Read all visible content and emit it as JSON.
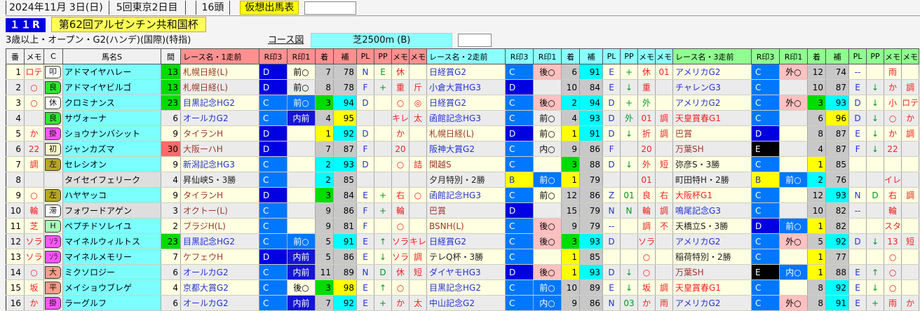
{
  "header": {
    "date": "2024年11月 3日(日)",
    "meeting": "5回東京2日目",
    "head_count": "16頭",
    "sheet_label": "仮想出馬表",
    "race_no": "１１R",
    "race_title": "第62回アルゼンチン共和国杯",
    "conditions": "3歳以上・オープン・G2(ハンデ)(国際)(特指)",
    "course_link": "コース図",
    "course": "芝2500m (B)"
  },
  "colors": {
    "top_bg": "#F4F4F4",
    "row_odd": "#FFFFE2",
    "row_even": "#EBEBEB",
    "name_cyan": "#7CFFFF",
    "name_gray": "#DEDEDE",
    "gap_green": "#00DC00",
    "gap_red": "#FF6A6A",
    "place1": "#FFFF00",
    "place2": "#00FFFF",
    "place3": "#00DC00",
    "place_other": "#C8C8C8",
    "mark_c": "#0077FF",
    "mark_d": "#0000E0",
    "mark_b_bg": "#FFFF00",
    "mark_e_bg": "#000000",
    "pos_pink": "#FFC0C0",
    "pos_blue": "#0077FF",
    "pos_navy": "#1414D2",
    "grade_g": "#2233CC",
    "grade_op": "#993928",
    "grade_g1": "#EE2222",
    "grade_cond": "#222222",
    "memo_red": "#EE2222",
    "pp_green": "#009922",
    "pl_blue": "#2233CC",
    "head_g1": "#FF9090",
    "head_g2": "#8CFFFF",
    "head_g3": "#90FF90",
    "head_left": "#F0F0F0",
    "race_no_bg": "#0000DD",
    "title_bg": "#FFFF55",
    "sheet_bg": "#FFFF00",
    "course_bg": "#8CFFFF",
    "tags": {
      "white": "#FFFFFF",
      "green": "#33E633",
      "magenta": "#FF55FF",
      "cream": "#FFF8C8",
      "olive": "#B8A820",
      "pgreen": "#AAFFBB",
      "salmon": "#FF9C8C"
    }
  },
  "table": {
    "left_columns": [
      "番",
      "メモ",
      "C",
      "馬名S",
      "間"
    ],
    "group_labels": [
      "レース名・1走前",
      "レース名・2走前",
      "レース名・3走前"
    ],
    "sub_columns": [
      "R印3",
      "R印1",
      "着",
      "補",
      "PL",
      "PP",
      "メモ",
      "メモ"
    ],
    "rows": [
      {
        "num": "1",
        "memo": "ロテ",
        "c": "叩",
        "cbg": "white",
        "name": "アドマイヤハレー",
        "nbg": "c",
        "gap": "13",
        "gbg": "g",
        "races": [
          {
            "race": "札幌日経(L)",
            "k": "o",
            "r3": "D",
            "r1": "前○",
            "r1s": "none",
            "fin": "7",
            "ho": "78",
            "pl": "N",
            "pp": "E",
            "m1": "休",
            "m2": ""
          },
          {
            "race": "日経賞G2",
            "k": "g",
            "r3": "C",
            "r1": "後○",
            "r1s": "pink",
            "fin": "6",
            "ho": "91",
            "pl": "E",
            "pp": "+",
            "m1": "休",
            "m2": "01"
          },
          {
            "race": "アメリカG2",
            "k": "g",
            "r3": "C",
            "r1": "外○",
            "r1s": "pink",
            "fin": "12",
            "ho": "74",
            "pl": "--",
            "pp": "",
            "m1": "雨",
            "m2": ""
          }
        ]
      },
      {
        "num": "2",
        "memo": "○",
        "c": "良",
        "cbg": "green",
        "name": "アドマイヤビルゴ",
        "nbg": "c",
        "gap": "13",
        "gbg": "g",
        "races": [
          {
            "race": "札幌日経(L)",
            "k": "o",
            "r3": "D",
            "r1": "前○",
            "r1s": "none",
            "fin": "8",
            "ho": "78",
            "pl": "F",
            "pp": "+",
            "m1": "重",
            "m2": "斤"
          },
          {
            "race": "小倉大賞HG3",
            "k": "g",
            "r3": "D",
            "r1": "",
            "r1s": "none",
            "fin": "10",
            "ho": "84",
            "pl": "E",
            "pp": "↓",
            "m1": "重",
            "m2": ""
          },
          {
            "race": "チャレンG3",
            "k": "g",
            "r3": "C",
            "r1": "",
            "r1s": "none",
            "fin": "10",
            "ho": "87",
            "pl": "E",
            "pp": "↓",
            "m1": "か",
            "m2": "調"
          }
        ]
      },
      {
        "num": "3",
        "memo": "○",
        "c": "休",
        "cbg": "white",
        "name": "クロミナンス",
        "nbg": "c",
        "gap": "23",
        "gbg": "g",
        "races": [
          {
            "race": "目黒記念HG2",
            "k": "g",
            "r3": "C",
            "r1": "前○",
            "r1s": "blue",
            "fin": "3",
            "ho": "94",
            "pl": "D",
            "pp": "",
            "m1": "○",
            "m2": "◎"
          },
          {
            "race": "日経賞G2",
            "k": "g",
            "r3": "C",
            "r1": "後○",
            "r1s": "pink",
            "fin": "2",
            "ho": "94",
            "pl": "D",
            "pp": "+",
            "m1": "外",
            "m1g": true,
            "m2": ""
          },
          {
            "race": "アメリカG2",
            "k": "g",
            "r3": "C",
            "r1": "外○",
            "r1s": "pink",
            "fin": "3",
            "ho": "93",
            "pl": "D",
            "pp": "↓",
            "m1": "小",
            "m2": "ロテ"
          }
        ]
      },
      {
        "num": "4",
        "memo": "",
        "c": "良",
        "cbg": "green",
        "name": "サヴォーナ",
        "nbg": "c",
        "gap": "6",
        "gbg": "",
        "races": [
          {
            "race": "オールカG2",
            "k": "g",
            "r3": "C",
            "r1": "内前",
            "r1s": "navy",
            "fin": "4",
            "ho": "95",
            "pl": "",
            "pp": "",
            "m1": "キレ",
            "m2": "太"
          },
          {
            "race": "函館記念HG3",
            "k": "g",
            "r3": "C",
            "r1": "前○",
            "r1s": "none",
            "fin": "4",
            "ho": "93",
            "pl": "D",
            "pp": "外",
            "m1": "01",
            "m2": "調"
          },
          {
            "race": "天皇賞春G1",
            "k": "1",
            "r3": "C",
            "r1": "",
            "r1s": "none",
            "fin": "6",
            "ho": "96",
            "pl": "D",
            "pp": "↓",
            "m1": "○",
            "m2": "か"
          }
        ]
      },
      {
        "num": "5",
        "memo": "か",
        "c": "掛",
        "cbg": "magenta",
        "name": "ショウナンバシット",
        "nbg": "c",
        "gap": "9",
        "gbg": "",
        "races": [
          {
            "race": "タイランH",
            "k": "o",
            "r3": "D",
            "r1": "",
            "r1s": "none",
            "fin": "1",
            "ho": "92",
            "pl": "D",
            "pp": "",
            "m1": "か",
            "m2": ""
          },
          {
            "race": "札幌日経(L)",
            "k": "o",
            "r3": "D",
            "r1": "前○",
            "r1s": "none",
            "fin": "1",
            "ho": "91",
            "pl": "D",
            "pp": "↓",
            "m1": "折",
            "m2": "調"
          },
          {
            "race": "巴賞",
            "k": "o",
            "r3": "D",
            "r1": "",
            "r1s": "none",
            "fin": "8",
            "ho": "87",
            "pl": "E",
            "pp": "↓",
            "m1": "か",
            "m2": "調"
          }
        ]
      },
      {
        "num": "6",
        "memo": "22",
        "c": "初",
        "cbg": "cream",
        "name": "ジャンカズマ",
        "nbg": "c",
        "gap": "30",
        "gbg": "r",
        "races": [
          {
            "race": "大阪ーハH",
            "k": "o",
            "r3": "D",
            "r1": "",
            "r1s": "none",
            "fin": "7",
            "ho": "87",
            "pl": "F",
            "pp": "",
            "m1": "20",
            "m2": ""
          },
          {
            "race": "阪神大賞G2",
            "k": "g",
            "r3": "C",
            "r1": "内○",
            "r1s": "none",
            "fin": "9",
            "ho": "86",
            "pl": "F",
            "pp": "",
            "m1": "20",
            "m2": ""
          },
          {
            "race": "万葉SH",
            "k": "o",
            "r3": "E",
            "r1": "",
            "r1s": "none",
            "fin": "4",
            "ho": "87",
            "pl": "F",
            "pp": "↓",
            "m1": "22",
            "m2": ""
          }
        ]
      },
      {
        "num": "7",
        "memo": "調",
        "c": "左",
        "cbg": "olive",
        "name": "セレシオン",
        "nbg": "c",
        "gap": "9",
        "gbg": "",
        "races": [
          {
            "race": "新潟記念HG3",
            "k": "g",
            "r3": "C",
            "r1": "",
            "r1s": "none",
            "fin": "2",
            "ho": "93",
            "pl": "D",
            "pp": "",
            "m1": "○",
            "m2": "詰"
          },
          {
            "race": "関越S",
            "k": "o",
            "r3": "C",
            "r1": "",
            "r1s": "none",
            "fin": "3",
            "ho": "88",
            "pl": "D",
            "pp": "↓",
            "m1": "外",
            "m2": "短"
          },
          {
            "race": "弥彦S・3勝",
            "k": "j",
            "r3": "C",
            "r1": "",
            "r1s": "none",
            "fin": "1",
            "ho": "85",
            "pl": "",
            "pp": "",
            "m1": "",
            "m2": ""
          }
        ]
      },
      {
        "num": "8",
        "memo": "",
        "c": "",
        "cbg": "",
        "name": "タイセイフェリーク",
        "nbg": "gy",
        "gap": "4",
        "gbg": "",
        "races": [
          {
            "race": "昇仙峡S・3勝",
            "k": "j",
            "r3": "C",
            "r1": "",
            "r1s": "none",
            "fin": "2",
            "ho": "85",
            "pl": "",
            "pp": "",
            "m1": "",
            "m2": ""
          },
          {
            "race": "夕月特別・2勝",
            "k": "j",
            "r3": "B",
            "r1": "前○",
            "r1s": "blue",
            "fin": "1",
            "ho": "79",
            "pl": "",
            "pp": "",
            "m1": "01",
            "m2": ""
          },
          {
            "race": "町田特H・2勝",
            "k": "j",
            "r3": "B",
            "r1": "前○",
            "r1s": "blue",
            "fin": "2",
            "ho": "76",
            "pl": "",
            "pp": "",
            "m1": "イレ",
            "m2": ""
          }
        ]
      },
      {
        "num": "9",
        "memo": "○",
        "c": "左",
        "cbg": "olive",
        "name": "ハヤヤッコ",
        "nbg": "c",
        "gap": "9",
        "gbg": "",
        "races": [
          {
            "race": "タイランH",
            "k": "o",
            "r3": "D",
            "r1": "",
            "r1s": "none",
            "fin": "3",
            "ho": "84",
            "pl": "E",
            "pp": "+",
            "m1": "右",
            "m2": "○"
          },
          {
            "race": "函館記念HG3",
            "k": "g",
            "r3": "C",
            "r1": "前○",
            "r1s": "none",
            "fin": "12",
            "ho": "86",
            "pl": "Z",
            "pp": "01",
            "m1": "良",
            "m2": "右"
          },
          {
            "race": "大阪杯G1",
            "k": "1",
            "r3": "C",
            "r1": "",
            "r1s": "none",
            "fin": "12",
            "ho": "93",
            "pl": "N",
            "pp": "D",
            "m1": "右",
            "m2": "調"
          }
        ]
      },
      {
        "num": "10",
        "memo": "輪",
        "c": "滞",
        "cbg": "white",
        "name": "フォワードアゲン",
        "nbg": "gy",
        "gap": "3",
        "gbg": "",
        "races": [
          {
            "race": "オクトー(L)",
            "k": "o",
            "r3": "C",
            "r1": "",
            "r1s": "none",
            "fin": "9",
            "ho": "86",
            "pl": "F",
            "pp": "+",
            "m1": "輪",
            "m2": ""
          },
          {
            "race": "巴賞",
            "k": "o",
            "r3": "D",
            "r1": "",
            "r1s": "none",
            "fin": "15",
            "ho": "79",
            "pl": "N",
            "pp": "N",
            "m1": "輪",
            "m2": "調"
          },
          {
            "race": "鳴尾記念G3",
            "k": "g",
            "r3": "C",
            "r1": "",
            "r1s": "none",
            "fin": "10",
            "ho": "82",
            "pl": "--",
            "pp": "",
            "m1": "輪",
            "m2": ""
          }
        ]
      },
      {
        "num": "11",
        "memo": "芝",
        "c": "H",
        "cbg": "pgreen",
        "name": "ペプチドソレイユ",
        "nbg": "c",
        "gap": "2",
        "gbg": "",
        "races": [
          {
            "race": "ブラジH(L)",
            "k": "o",
            "r3": "C",
            "r1": "",
            "r1s": "none",
            "fin": "9",
            "ho": "81",
            "pl": "F",
            "pp": "",
            "m1": "○",
            "m2": ""
          },
          {
            "race": "BSNH(L)",
            "k": "o",
            "r3": "C",
            "r1": "後○",
            "r1s": "pink",
            "fin": "9",
            "ho": "79",
            "pl": "--",
            "pp": "",
            "m1": "調",
            "m2": "不"
          },
          {
            "race": "天橋立S・3勝",
            "k": "j",
            "r3": "D",
            "r1": "前○",
            "r1s": "blue",
            "fin": "1",
            "ho": "82",
            "pl": "",
            "pp": "",
            "m1": "スタ",
            "m2": ""
          }
        ]
      },
      {
        "num": "12",
        "memo": "ソラ",
        "c": "ソラ",
        "cbg": "magenta",
        "name": "マイネルウィルトス",
        "nbg": "c",
        "gap": "23",
        "gbg": "g",
        "races": [
          {
            "race": "目黒記念HG2",
            "k": "g",
            "r3": "C",
            "r1": "前○",
            "r1s": "blue",
            "fin": "5",
            "ho": "91",
            "pl": "E",
            "pp": "↑",
            "m1": "ソラ",
            "m2": "キレ"
          },
          {
            "race": "日経賞G2",
            "k": "g",
            "r3": "C",
            "r1": "後○",
            "r1s": "pink",
            "fin": "3",
            "ho": "93",
            "pl": "D",
            "pp": "",
            "m1": "ソラ",
            "m2": ""
          },
          {
            "race": "アメリカG2",
            "k": "g",
            "r3": "C",
            "r1": "外○",
            "r1s": "pink",
            "fin": "5",
            "ho": "92",
            "pl": "D",
            "pp": "↓",
            "m1": "13",
            "m2": "短"
          }
        ]
      },
      {
        "num": "13",
        "memo": "ソラ",
        "c": "ソラ",
        "cbg": "magenta",
        "name": "マイネルメモリー",
        "nbg": "c",
        "gap": "7",
        "gbg": "",
        "races": [
          {
            "race": "ケフェウH",
            "k": "o",
            "r3": "D",
            "r1": "内前",
            "r1s": "navy",
            "fin": "5",
            "ho": "86",
            "pl": "E",
            "pp": "↓",
            "m1": "ソラ",
            "m2": "調"
          },
          {
            "race": "テレQ杯・3勝",
            "k": "j",
            "r3": "C",
            "r1": "",
            "r1s": "none",
            "fin": "1",
            "ho": "85",
            "pl": "",
            "pp": "",
            "m1": "○",
            "m2": ""
          },
          {
            "race": "稲荷特別・2勝",
            "k": "j",
            "r3": "C",
            "r1": "",
            "r1s": "none",
            "fin": "1",
            "ho": "77",
            "pl": "",
            "pp": "",
            "m1": "○",
            "m2": ""
          }
        ]
      },
      {
        "num": "14",
        "memo": "○",
        "c": "大",
        "cbg": "salmon",
        "name": "ミクソロジー",
        "nbg": "c",
        "gap": "6",
        "gbg": "",
        "races": [
          {
            "race": "オールカG2",
            "k": "g",
            "r3": "C",
            "r1": "内前",
            "r1s": "navy",
            "fin": "11",
            "ho": "89",
            "pl": "N",
            "pp": "D",
            "m1": "休",
            "m2": "短"
          },
          {
            "race": "ダイヤモHG3",
            "k": "g",
            "r3": "D",
            "r1": "後○",
            "r1s": "pink",
            "fin": "1",
            "ho": "93",
            "pl": "D",
            "pp": "↓",
            "m1": "○",
            "m2": ""
          },
          {
            "race": "万葉SH",
            "k": "o",
            "r3": "E",
            "r1": "内○",
            "r1s": "blue",
            "fin": "1",
            "ho": "88",
            "pl": "E",
            "pp": "↑",
            "m1": "○",
            "m2": ""
          }
        ]
      },
      {
        "num": "15",
        "memo": "坂",
        "c": "平",
        "cbg": "salmon",
        "name": "メイショウブレゲ",
        "nbg": "c",
        "gap": "4",
        "gbg": "",
        "races": [
          {
            "race": "京都大賞G2",
            "k": "g",
            "r3": "C",
            "r1": "後○",
            "r1s": "none",
            "fin": "3",
            "ho": "98",
            "pl": "E",
            "pp": "↑",
            "m1": "○",
            "m2": ""
          },
          {
            "race": "目黒記念HG2",
            "k": "g",
            "r3": "C",
            "r1": "前○",
            "r1s": "blue",
            "fin": "10",
            "ho": "89",
            "pl": "E",
            "pp": "↓",
            "m1": "坂",
            "m2": "調"
          },
          {
            "race": "天皇賞春G1",
            "k": "1",
            "r3": "C",
            "r1": "",
            "r1s": "none",
            "fin": "8",
            "ho": "92",
            "pl": "E",
            "pp": "↓",
            "m1": "○",
            "m2": ""
          }
        ]
      },
      {
        "num": "16",
        "memo": "か",
        "c": "掛",
        "cbg": "magenta",
        "name": "ラーグルフ",
        "nbg": "c",
        "gap": "6",
        "gbg": "",
        "races": [
          {
            "race": "オールカG2",
            "k": "g",
            "r3": "C",
            "r1": "内前",
            "r1s": "navy",
            "fin": "7",
            "ho": "92",
            "pl": "E",
            "pp": "+",
            "m1": "か",
            "m2": "太"
          },
          {
            "race": "中山記念G2",
            "k": "g",
            "r3": "C",
            "r1": "内○",
            "r1s": "blue",
            "fin": "9",
            "ho": "86",
            "pl": "N",
            "pp": "03",
            "m1": "か",
            "m2": "雨"
          },
          {
            "race": "アメリカG2",
            "k": "g",
            "r3": "C",
            "r1": "外○",
            "r1s": "pink",
            "fin": "8",
            "ho": "91",
            "pl": "E",
            "pp": "+",
            "m1": "雨",
            "m2": "か"
          }
        ]
      }
    ]
  }
}
